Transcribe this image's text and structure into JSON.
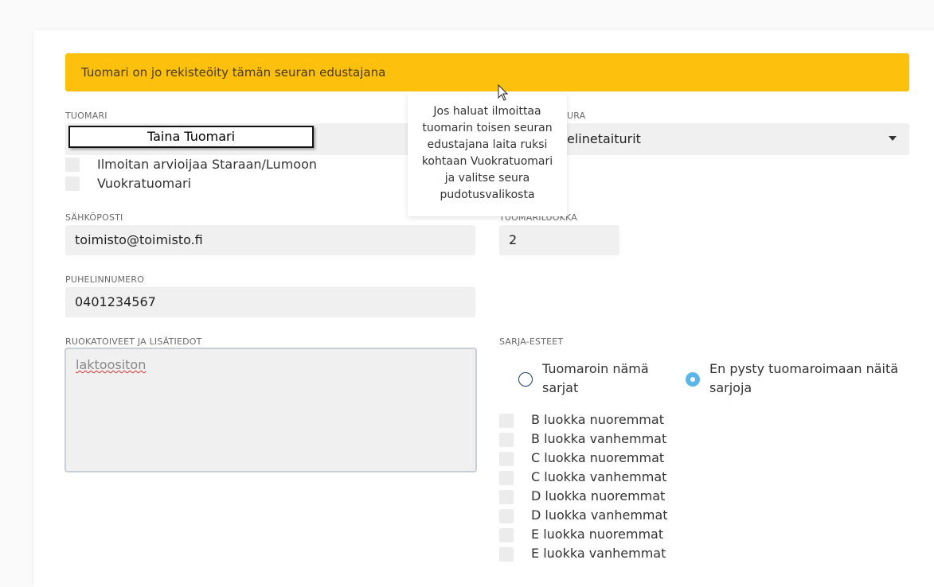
{
  "alert": {
    "text": "Tuomari on jo rekisteöity tämän seuran edustajana"
  },
  "tooltip": {
    "text": "Jos haluat ilmoittaa tuomarin toisen seuran edustajana laita ruksi kohtaan Vuokratuomari ja valitse seura pudotusvalikosta"
  },
  "judge": {
    "label": "TUOMARI",
    "autocomplete_value": "Taina Tuomari"
  },
  "club": {
    "label": "URA",
    "selected_value": "elinetaiturit"
  },
  "checkboxes": [
    {
      "label": "Ilmoitan arvioijaa Staraan/Lumoon",
      "checked": false
    },
    {
      "label": "Vuokratuomari",
      "checked": false
    }
  ],
  "email": {
    "label": "SÄHKÖPOSTI",
    "value": "toimisto@toimisto.fi"
  },
  "judge_class": {
    "label": "TUOMARILUOKKA",
    "value": "2"
  },
  "phone": {
    "label": "PUHELINNUMERO",
    "value": "0401234567"
  },
  "notes": {
    "label": "RUOKATOIVEET JA LISÄTIEDOT",
    "value": "laktoositon"
  },
  "series": {
    "label": "SARJA-ESTEET",
    "radio_options": [
      {
        "label": "Tuomaroin nämä sarjat",
        "selected": false
      },
      {
        "label": "En pysty tuomaroimaan näitä sarjoja",
        "selected": true
      }
    ],
    "items": [
      {
        "label": "B luokka nuoremmat"
      },
      {
        "label": "B luokka vanhemmat"
      },
      {
        "label": "C luokka nuoremmat"
      },
      {
        "label": "C luokka vanhemmat"
      },
      {
        "label": "D luokka nuoremmat"
      },
      {
        "label": "D luokka vanhemmat"
      },
      {
        "label": "E luokka nuoremmat"
      },
      {
        "label": "E luokka vanhemmat"
      }
    ]
  },
  "colors": {
    "alert_bg": "#fdc10d",
    "radio_selected": "#5ab5e8",
    "field_bg": "#f0f0f0"
  }
}
